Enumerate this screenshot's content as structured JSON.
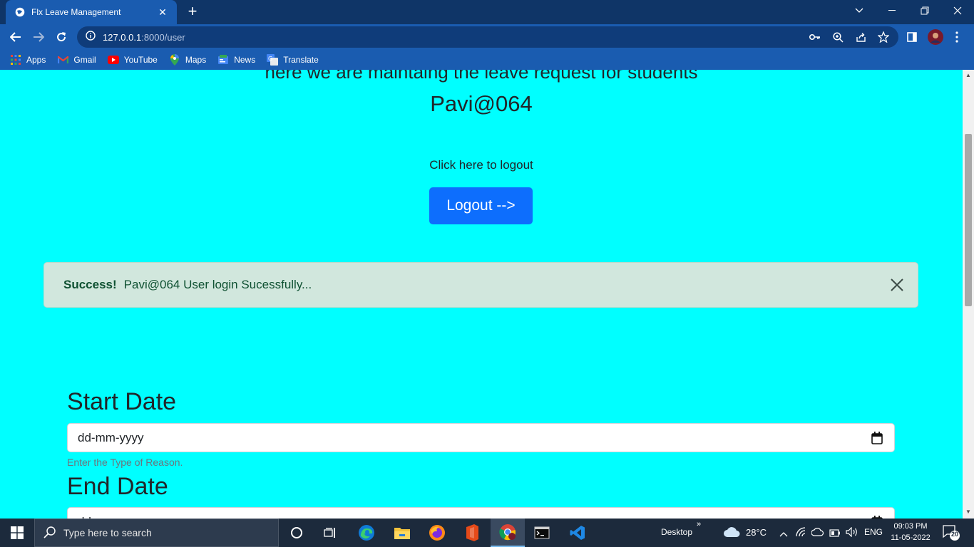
{
  "browser": {
    "tab_title": "Flx Leave Management",
    "url_host": "127.0.0.1",
    "url_path": ":8000/user",
    "bookmarks": [
      {
        "label": "Apps",
        "icon": "apps-grid-icon"
      },
      {
        "label": "Gmail",
        "icon": "gmail-icon"
      },
      {
        "label": "YouTube",
        "icon": "youtube-icon"
      },
      {
        "label": "Maps",
        "icon": "maps-icon"
      },
      {
        "label": "News",
        "icon": "news-icon"
      },
      {
        "label": "Translate",
        "icon": "translate-icon"
      }
    ]
  },
  "page": {
    "subheading": "here we are maintaing the leave request for students",
    "username": "Pavi@064",
    "logout_prompt": "Click here to logout",
    "logout_button": "Logout -->",
    "alert": {
      "title": "Success!",
      "message": "Pavi@064 User login Sucessfully..."
    },
    "form": {
      "start_label": "Start Date",
      "start_placeholder": "dd-mm-yyyy",
      "help_text": "Enter the Type of Reason.",
      "end_label": "End Date",
      "end_placeholder": "dd-mm-yyyy"
    }
  },
  "taskbar": {
    "search_placeholder": "Type here to search",
    "desktop_label": "Desktop",
    "temperature": "28°C",
    "language": "ENG",
    "time": "09:03 PM",
    "date": "11-05-2022",
    "notification_count": "20"
  },
  "colors": {
    "page_background": "#00ffff",
    "primary_button": "#0d6efd",
    "alert_background": "#d1e7dd",
    "browser_chrome": "#1a5cb0"
  }
}
